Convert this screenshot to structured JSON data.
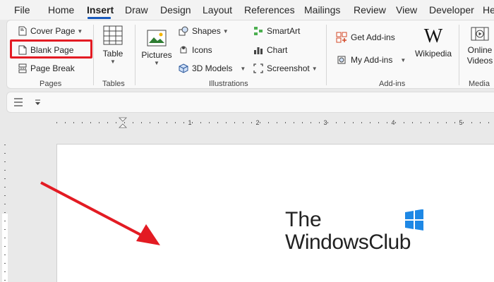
{
  "menu": {
    "tabs": [
      "File",
      "Home",
      "Insert",
      "Draw",
      "Design",
      "Layout",
      "References",
      "Mailings",
      "Review",
      "View",
      "Developer",
      "He"
    ],
    "active": "Insert"
  },
  "ribbon": {
    "pages": {
      "cover_page": "Cover Page",
      "blank_page": "Blank Page",
      "page_break": "Page Break",
      "label": "Pages"
    },
    "tables": {
      "table": "Table",
      "label": "Tables"
    },
    "illustrations": {
      "pictures": "Pictures",
      "shapes": "Shapes",
      "icons": "Icons",
      "models_3d": "3D Models",
      "smartart": "SmartArt",
      "chart": "Chart",
      "screenshot": "Screenshot",
      "label": "Illustrations"
    },
    "addins": {
      "get_addins": "Get Add-ins",
      "my_addins": "My Add-ins",
      "wikipedia": "Wikipedia",
      "label": "Add-ins"
    },
    "media": {
      "online": "Online",
      "videos": "Videos",
      "label": "Media"
    }
  },
  "ruler": {
    "numbers": [
      "1",
      "2",
      "3",
      "4",
      "5"
    ]
  },
  "document": {
    "logo_the": "The",
    "logo_main": "WindowsClub"
  },
  "colors": {
    "accent": "#185abd",
    "highlight": "#e31b23",
    "arrow": "#e31b23"
  }
}
